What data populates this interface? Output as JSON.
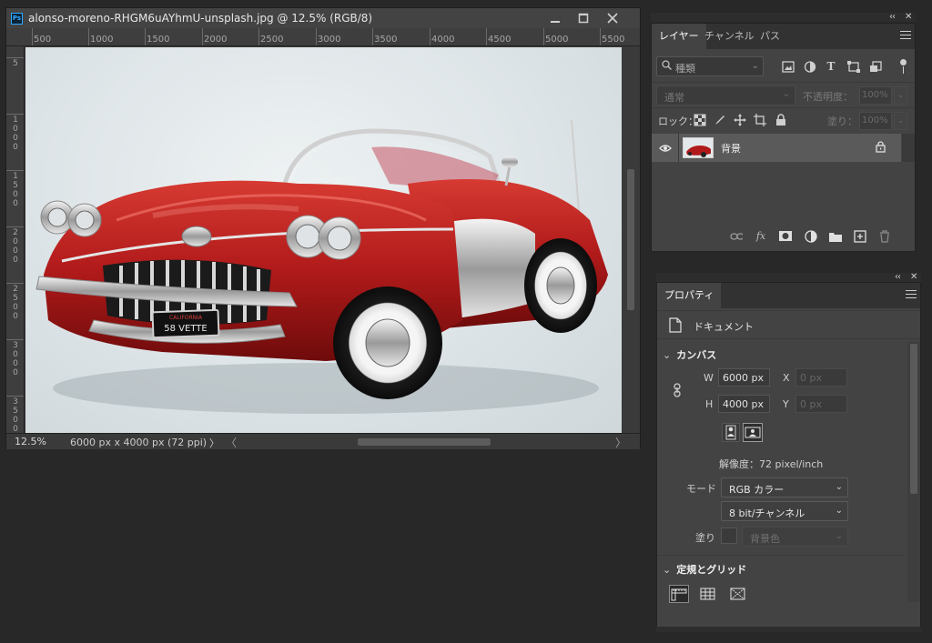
{
  "document": {
    "title": "alonso-moreno-RHGM6uAYhmU-unsplash.jpg @ 12.5% (RGB/8)",
    "app_icon": "Ps",
    "ruler_top": [
      "500",
      "1000",
      "1500",
      "2000",
      "2500",
      "3000",
      "3500",
      "4000",
      "4500",
      "5000",
      "5500"
    ],
    "ruler_left": [
      "5",
      "1000",
      "1500",
      "2000",
      "2500",
      "3000",
      "3500"
    ],
    "window_buttons": [
      "minimize-icon",
      "maximize-icon",
      "close-icon"
    ],
    "plate_top": "CALIFORNIA",
    "plate_text": "58 VETTE"
  },
  "status": {
    "zoom": "12.5%",
    "size": "6000 px x 4000 px (72 ppi)",
    "arrow": "〉",
    "scroll_left": "〈",
    "scroll_right": "〉"
  },
  "layers_panel": {
    "tabs": [
      "レイヤー",
      "チャンネル",
      "パス"
    ],
    "active_tab": 0,
    "search_placeholder": "種類",
    "blend_mode": "通常",
    "opacity_label": "不透明度：",
    "opacity_value": "100%",
    "lock_label": "ロック：",
    "fill_label": "塗り：",
    "fill_value": "100%",
    "layer": {
      "name": "背景",
      "visible": true,
      "locked": true
    },
    "footer_icons": [
      "link-icon",
      "fx-icon",
      "mask-icon",
      "adjustment-icon",
      "folder-icon",
      "new-layer-icon",
      "trash-icon"
    ],
    "fx_text": "fx"
  },
  "properties_panel": {
    "tab": "プロパティ",
    "doc_label": "ドキュメント",
    "canvas_section": "カンバス",
    "w_label": "W",
    "w_value": "6000 px",
    "h_label": "H",
    "h_value": "4000 px",
    "x_label": "X",
    "x_value": "0 px",
    "y_label": "Y",
    "y_value": "0 px",
    "resolution": "解像度：72 pixel/inch",
    "mode_label": "モード",
    "mode_value": "RGB カラー",
    "bit_value": "8 bit/チャンネル",
    "fill_label": "塗り",
    "fill_value": "背景色",
    "grid_section": "定規とグリッド"
  },
  "colors": {
    "app_bg": "#282828",
    "panel_bg": "#434343",
    "car_red": "#b01a1a",
    "accent": "#31a8ff"
  }
}
